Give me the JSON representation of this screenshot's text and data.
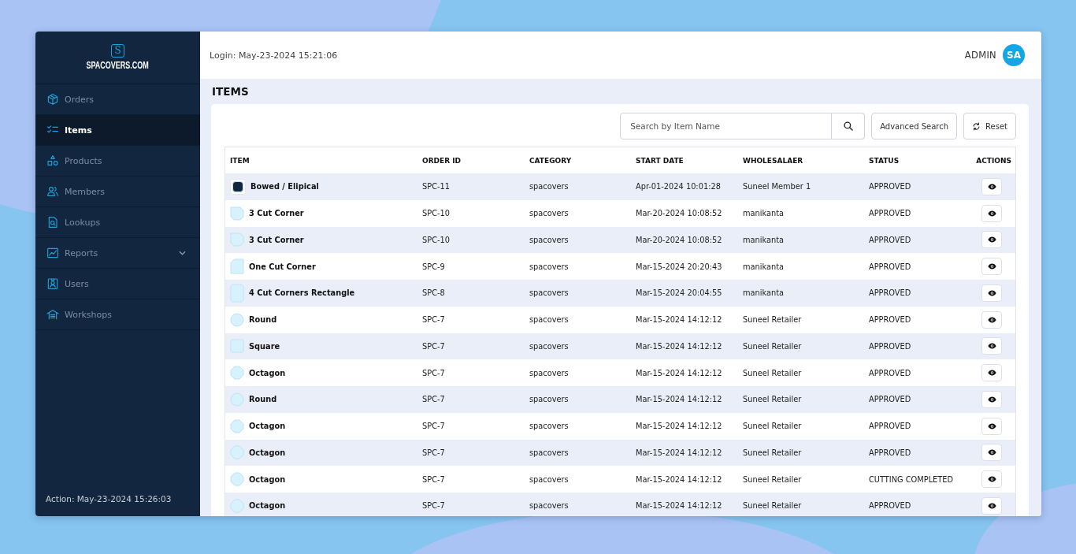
{
  "sidebar": {
    "logo": {
      "mark": "S",
      "name": "SPACOVERS.COM"
    },
    "items": [
      {
        "label": "Orders",
        "selected": false
      },
      {
        "label": "Items",
        "selected": true
      },
      {
        "label": "Products",
        "selected": false
      },
      {
        "label": "Members",
        "selected": false
      },
      {
        "label": "Lookups",
        "selected": false
      },
      {
        "label": "Reports",
        "selected": false,
        "expanded": false
      },
      {
        "label": "Users",
        "selected": false
      },
      {
        "label": "Workshops",
        "selected": false
      }
    ],
    "footer": "Action: May-23-2024 15:26:03"
  },
  "top_bar": {
    "login": "Login: May-23-2024 15:21:06",
    "user": "ADMIN",
    "avatar": "SA"
  },
  "page_title": "ITEMS",
  "toolbar": {
    "search": {
      "placeholder": "Search by Item Name"
    },
    "buttons": [
      {
        "label": "Advanced Search",
        "kind": "advanced"
      },
      {
        "label": "Reset",
        "kind": "reset"
      }
    ]
  },
  "table": {
    "columns": [
      "ITEM",
      "ORDER ID",
      "CATEGORY",
      "START DATE",
      "WHOLESALAER",
      "STATUS",
      "ACTIONS"
    ],
    "rows": [
      {
        "kind": "bowed",
        "item": "Bowed / Elipical",
        "order_id": "SPC-11",
        "category": "spacovers",
        "start_date": "Apr-01-2024 10:01:28",
        "wholesaler": "Suneel Member 1",
        "status": "APPROVED"
      },
      {
        "kind": "three-cut",
        "item": "3 Cut Corner",
        "order_id": "SPC-10",
        "category": "spacovers",
        "start_date": "Mar-20-2024 10:08:52",
        "wholesaler": "manikanta",
        "status": "APPROVED"
      },
      {
        "kind": "three-cut",
        "item": "3 Cut Corner",
        "order_id": "SPC-10",
        "category": "spacovers",
        "start_date": "Mar-20-2024 10:08:52",
        "wholesaler": "manikanta",
        "status": "APPROVED"
      },
      {
        "kind": "one-cut",
        "item": "One Cut Corner",
        "order_id": "SPC-9",
        "category": "spacovers",
        "start_date": "Mar-15-2024 20:20:43",
        "wholesaler": "manikanta",
        "status": "APPROVED"
      },
      {
        "kind": "four-cut",
        "item": "4 Cut Corners Rectangle",
        "order_id": "SPC-8",
        "category": "spacovers",
        "start_date": "Mar-15-2024 20:04:55",
        "wholesaler": "manikanta",
        "status": "APPROVED"
      },
      {
        "kind": "round",
        "item": "Round",
        "order_id": "SPC-7",
        "category": "spacovers",
        "start_date": "Mar-15-2024 14:12:12",
        "wholesaler": "Suneel Retailer",
        "status": "APPROVED"
      },
      {
        "kind": "square",
        "item": "Square",
        "order_id": "SPC-7",
        "category": "spacovers",
        "start_date": "Mar-15-2024 14:12:12",
        "wholesaler": "Suneel Retailer",
        "status": "APPROVED"
      },
      {
        "kind": "octagon",
        "item": "Octagon",
        "order_id": "SPC-7",
        "category": "spacovers",
        "start_date": "Mar-15-2024 14:12:12",
        "wholesaler": "Suneel Retailer",
        "status": "APPROVED"
      },
      {
        "kind": "round",
        "item": "Round",
        "order_id": "SPC-7",
        "category": "spacovers",
        "start_date": "Mar-15-2024 14:12:12",
        "wholesaler": "Suneel Retailer",
        "status": "APPROVED"
      },
      {
        "kind": "octagon",
        "item": "Octagon",
        "order_id": "SPC-7",
        "category": "spacovers",
        "start_date": "Mar-15-2024 14:12:12",
        "wholesaler": "Suneel Retailer",
        "status": "APPROVED"
      },
      {
        "kind": "octagon",
        "item": "Octagon",
        "order_id": "SPC-7",
        "category": "spacovers",
        "start_date": "Mar-15-2024 14:12:12",
        "wholesaler": "Suneel Retailer",
        "status": "APPROVED"
      },
      {
        "kind": "octagon",
        "item": "Octagon",
        "order_id": "SPC-7",
        "category": "spacovers",
        "start_date": "Mar-15-2024 14:12:12",
        "wholesaler": "Suneel Retailer",
        "status": "CUTTING COMPLETED"
      },
      {
        "kind": "octagon",
        "item": "Octagon",
        "order_id": "SPC-7",
        "category": "spacovers",
        "start_date": "Mar-15-2024 14:12:12",
        "wholesaler": "Suneel Retailer",
        "status": "APPROVED"
      }
    ]
  }
}
